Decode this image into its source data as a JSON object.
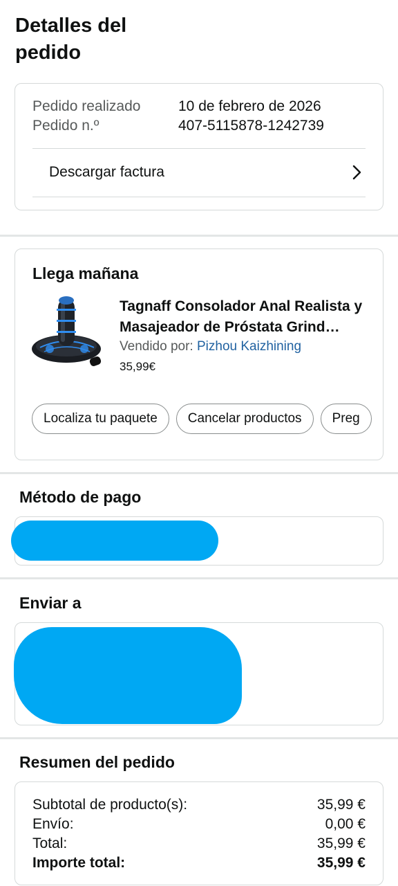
{
  "page_title": "Detalles del pedido",
  "order_info": {
    "placed_label": "Pedido realizado",
    "placed_value": "10 de febrero de 2026",
    "number_label": "Pedido n.º",
    "number_value": "407-5115878-1242739",
    "invoice_label": "Descargar factura"
  },
  "delivery": {
    "heading": "Llega mañana",
    "product_title": "Tagnaff Consolador Anal Realista y Masajeador de Próstata Grind…",
    "seller_label": "Vendido por:",
    "seller_name": "Pizhou Kaizhining",
    "price": "35,99€",
    "actions": [
      "Localiza tu paquete",
      "Cancelar productos",
      "Preg"
    ]
  },
  "payment": {
    "title": "Método de pago"
  },
  "shipping": {
    "title": "Enviar a"
  },
  "summary": {
    "title": "Resumen del pedido",
    "rows": [
      {
        "label": "Subtotal de producto(s):",
        "value": "35,99 €"
      },
      {
        "label": "Envío:",
        "value": "0,00 €"
      },
      {
        "label": "Total:",
        "value": "35,99 €"
      },
      {
        "label": "Importe total:",
        "value": "35,99 €"
      }
    ]
  },
  "colors": {
    "link": "#2162a1",
    "redaction": "#00a8f3",
    "border": "#d5d9d9"
  }
}
